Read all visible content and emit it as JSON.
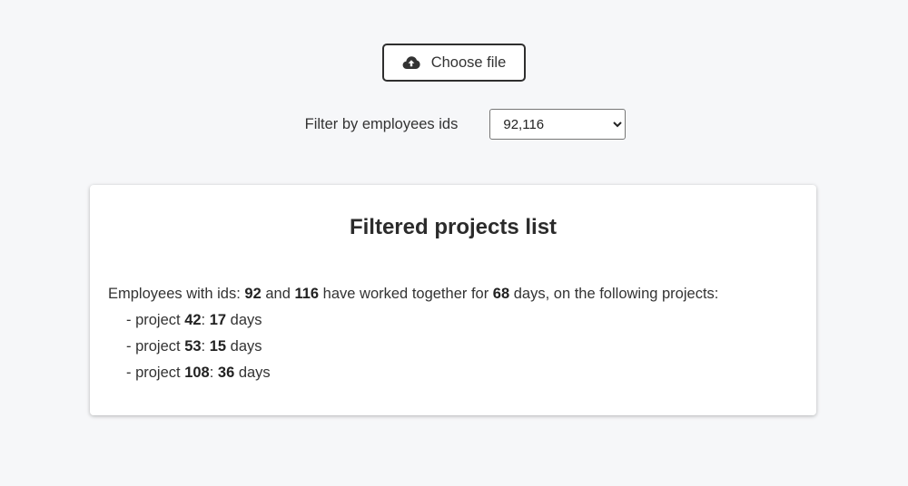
{
  "upload": {
    "button_label": "Choose file",
    "icon": "cloud-upload-icon"
  },
  "filter": {
    "label": "Filter by employees ids",
    "selected": "92,116"
  },
  "card": {
    "title": "Filtered projects list",
    "summary": {
      "prefix": "Employees with ids: ",
      "id1": "92",
      "and": " and ",
      "id2": "116",
      "mid": " have worked together for ",
      "days": "68",
      "suffix": " days, on the following projects:"
    },
    "projects": [
      {
        "prefix": "- project ",
        "id": "42",
        "sep": ": ",
        "days": "17",
        "unit": " days"
      },
      {
        "prefix": "- project ",
        "id": "53",
        "sep": ": ",
        "days": "15",
        "unit": " days"
      },
      {
        "prefix": "- project ",
        "id": "108",
        "sep": ": ",
        "days": "36",
        "unit": " days"
      }
    ]
  }
}
